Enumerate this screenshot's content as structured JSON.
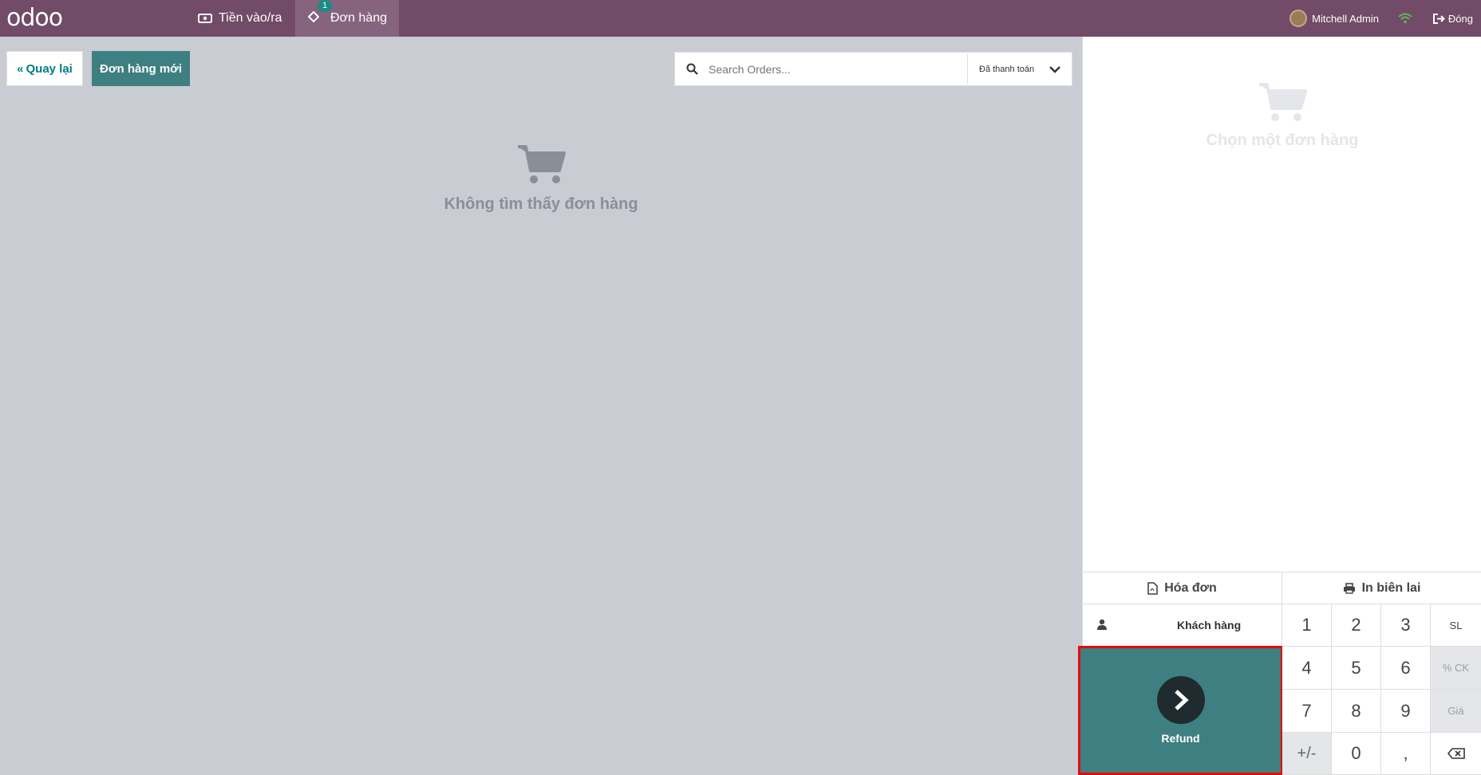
{
  "topbar": {
    "logo": "odoo",
    "cash_label": "Tiền vào/ra",
    "orders_label": "Đơn hàng",
    "orders_badge": "1",
    "user_name": "Mitchell Admin",
    "close_label": "Đóng"
  },
  "toolbar": {
    "back_label": "Quay lại",
    "new_order_label": "Đơn hàng mới",
    "search_placeholder": "Search Orders...",
    "filter_value": "Đã thanh toán"
  },
  "main": {
    "empty_text": "Không tìm thấy đơn hàng"
  },
  "detail": {
    "empty_text": "Chọn một đơn hàng"
  },
  "actions": {
    "invoice_label": "Hóa đơn",
    "print_label": "In biên lai",
    "customer_label": "Khách hàng",
    "refund_label": "Refund"
  },
  "numpad": {
    "k1": "1",
    "k2": "2",
    "k3": "3",
    "qty": "SL",
    "k4": "4",
    "k5": "5",
    "k6": "6",
    "disc": "% CK",
    "k7": "7",
    "k8": "8",
    "k9": "9",
    "price": "Giá",
    "plusminus": "+/-",
    "k0": "0",
    "comma": ","
  },
  "colors": {
    "topbar": "#714b67",
    "accent": "#3e7f82",
    "highlight": "#e10d0d"
  }
}
